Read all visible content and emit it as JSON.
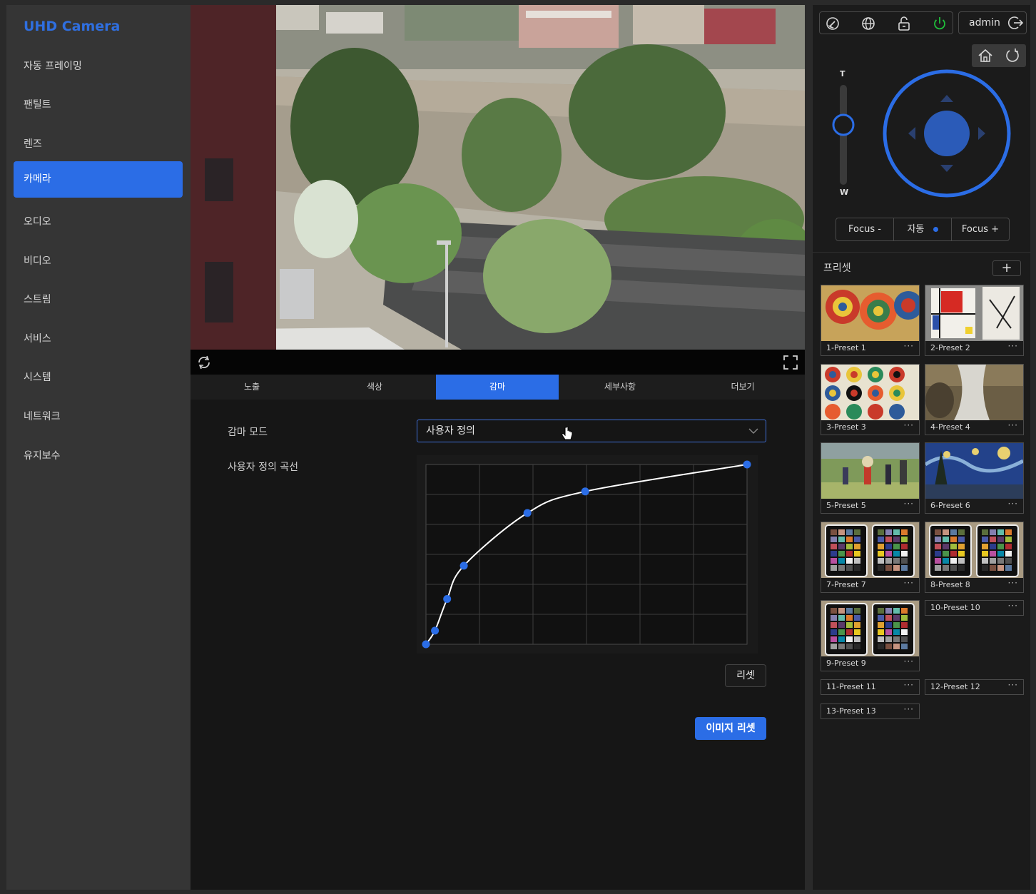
{
  "brand": "UHD Camera",
  "nav": [
    {
      "label": "자동 프레이밍",
      "active": false
    },
    {
      "label": "팬틸트",
      "active": false
    },
    {
      "label": "렌즈",
      "active": false
    },
    {
      "label": "카메라",
      "active": true
    },
    {
      "label": "오디오",
      "active": false
    },
    {
      "label": "비디오",
      "active": false
    },
    {
      "label": "스트림",
      "active": false
    },
    {
      "label": "서비스",
      "active": false
    },
    {
      "label": "시스템",
      "active": false
    },
    {
      "label": "네트워크",
      "active": false
    },
    {
      "label": "유지보수",
      "active": false
    }
  ],
  "tabs": [
    {
      "label": "노출",
      "active": false
    },
    {
      "label": "색상",
      "active": false
    },
    {
      "label": "감마",
      "active": true
    },
    {
      "label": "세부사항",
      "active": false
    },
    {
      "label": "더보기",
      "active": false
    }
  ],
  "gamma": {
    "mode_label": "감마 모드",
    "mode_value": "사용자 정의",
    "curve_label": "사용자 정의 곡선",
    "reset_label": "리셋",
    "image_reset_label": "이미지 리셋"
  },
  "chart_data": {
    "type": "line",
    "grid": {
      "cols": 6,
      "rows": 6
    },
    "xlim": [
      0,
      1
    ],
    "ylim": [
      0,
      1
    ],
    "points": [
      [
        0.0,
        0.0
      ],
      [
        0.028,
        0.076
      ],
      [
        0.066,
        0.252
      ],
      [
        0.118,
        0.437
      ],
      [
        0.316,
        0.73
      ],
      [
        0.496,
        0.85
      ],
      [
        1.0,
        1.0
      ]
    ],
    "line_color": "#ffffff",
    "point_color": "#2b6de6"
  },
  "header": {
    "user": "admin",
    "icons": [
      "dashboard-icon",
      "globe-icon",
      "unlock-icon",
      "power-icon",
      "logout-icon"
    ],
    "power_color": "#1fbf3a"
  },
  "ptz": {
    "zoom_top": "T",
    "zoom_bottom": "W",
    "zoom_level": 0.6,
    "accent": "#2b6de6"
  },
  "focus": {
    "minus": "Focus -",
    "auto": "자동",
    "plus": "Focus +"
  },
  "presets": {
    "title": "프리셋",
    "add": "+",
    "items": [
      {
        "label": "1-Preset 1",
        "thumb": "kandinsky-circles"
      },
      {
        "label": "2-Preset 2",
        "thumb": "mondrian"
      },
      {
        "label": "3-Preset 3",
        "thumb": "kandinsky-squares"
      },
      {
        "label": "4-Preset 4",
        "thumb": "waterfall"
      },
      {
        "label": "5-Preset 5",
        "thumb": "seurat"
      },
      {
        "label": "6-Preset 6",
        "thumb": "starry-night"
      },
      {
        "label": "7-Preset 7",
        "thumb": "color-checker"
      },
      {
        "label": "8-Preset 8",
        "thumb": "color-checker"
      },
      {
        "label": "10-Preset 10",
        "thumb": ""
      },
      {
        "label": "9-Preset 9",
        "thumb": "color-checker"
      },
      {
        "label": "11-Preset 11",
        "thumb": ""
      },
      {
        "label": "12-Preset 12",
        "thumb": ""
      },
      {
        "label": "13-Preset 13",
        "thumb": ""
      }
    ]
  }
}
